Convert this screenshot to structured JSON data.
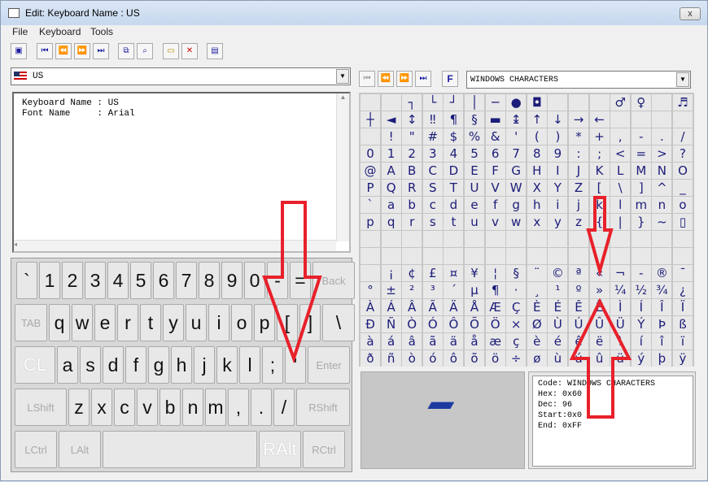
{
  "window": {
    "title": "Edit:  Keyboard Name : US",
    "close": "x"
  },
  "menu": [
    "File",
    "Keyboard",
    "Tools"
  ],
  "toolbar": {
    "icons": [
      "save-icon",
      "first-icon",
      "prev-icon",
      "next-icon",
      "last-icon",
      "copy-icon",
      "find-icon",
      "new-icon",
      "delete-icon",
      "print-preview-icon"
    ]
  },
  "left": {
    "combo_value": "US",
    "info_text": "Keyboard Name : US\nFont Name     : Arial",
    "keyboard": [
      [
        "`",
        "1",
        "2",
        "3",
        "4",
        "5",
        "6",
        "7",
        "8",
        "9",
        "0",
        "-",
        "=",
        "Back"
      ],
      [
        "TAB",
        "q",
        "w",
        "e",
        "r",
        "t",
        "y",
        "u",
        "i",
        "o",
        "p",
        "[",
        "]",
        "\\"
      ],
      [
        "CL",
        "a",
        "s",
        "d",
        "f",
        "g",
        "h",
        "j",
        "k",
        "l",
        ";",
        "'",
        "Enter"
      ],
      [
        "LShift",
        "z",
        "x",
        "c",
        "v",
        "b",
        "n",
        "m",
        ",",
        ".",
        "/",
        "RShift"
      ],
      [
        "LCtrl",
        "LAlt",
        "",
        "RAlt",
        "RCtrl"
      ]
    ]
  },
  "right": {
    "font_button": "F",
    "combo_value": "WINDOWS CHARACTERS",
    "grid": [
      [
        "",
        "",
        "┐",
        "└",
        "┘",
        "│",
        "─",
        "●",
        "◘",
        "",
        "",
        "",
        "♂",
        "♀",
        "",
        "♬",
        "☼"
      ],
      [
        "┼",
        "◄",
        "↕",
        "‼",
        "¶",
        "§",
        "▬",
        "↨",
        "↑",
        "↓",
        "→",
        "←",
        "",
        "",
        "",
        "",
        ""
      ],
      [
        "",
        "!",
        "\"",
        "#",
        "$",
        "%",
        "&",
        "'",
        "(",
        ")",
        "*",
        "+",
        ",",
        "-",
        ".",
        "/"
      ],
      [
        "0",
        "1",
        "2",
        "3",
        "4",
        "5",
        "6",
        "7",
        "8",
        "9",
        ":",
        ";",
        "<",
        "=",
        ">",
        "?"
      ],
      [
        "@",
        "A",
        "B",
        "C",
        "D",
        "E",
        "F",
        "G",
        "H",
        "I",
        "J",
        "K",
        "L",
        "M",
        "N",
        "O"
      ],
      [
        "P",
        "Q",
        "R",
        "S",
        "T",
        "U",
        "V",
        "W",
        "X",
        "Y",
        "Z",
        "[",
        "\\",
        "]",
        "^",
        "_"
      ],
      [
        "`",
        "a",
        "b",
        "c",
        "d",
        "e",
        "f",
        "g",
        "h",
        "i",
        "j",
        "k",
        "l",
        "m",
        "n",
        "o"
      ],
      [
        "p",
        "q",
        "r",
        "s",
        "t",
        "u",
        "v",
        "w",
        "x",
        "y",
        "z",
        "{",
        "|",
        "}",
        "~",
        "▯"
      ],
      [
        "",
        "",
        "",
        "",
        "",
        "",
        "",
        "",
        "",
        "",
        "",
        "",
        "",
        "",
        "",
        ""
      ],
      [
        "",
        "",
        "",
        "",
        "",
        "",
        "",
        "",
        "",
        "",
        "",
        "",
        "",
        "",
        "",
        ""
      ],
      [
        "",
        "¡",
        "¢",
        "£",
        "¤",
        "¥",
        "¦",
        "§",
        "¨",
        "©",
        "ª",
        "«",
        "¬",
        "-",
        "®",
        "¯"
      ],
      [
        "°",
        "±",
        "²",
        "³",
        "´",
        "µ",
        "¶",
        "·",
        "¸",
        "¹",
        "º",
        "»",
        "¼",
        "½",
        "¾",
        "¿"
      ],
      [
        "À",
        "Á",
        "Â",
        "Ã",
        "Ä",
        "Å",
        "Æ",
        "Ç",
        "È",
        "É",
        "Ê",
        "Ë",
        "Ì",
        "Í",
        "Î",
        "Ï"
      ],
      [
        "Ð",
        "Ñ",
        "Ò",
        "Ó",
        "Ô",
        "Õ",
        "Ö",
        "×",
        "Ø",
        "Ù",
        "Ú",
        "Û",
        "Ü",
        "Ý",
        "Þ",
        "ß"
      ],
      [
        "à",
        "á",
        "â",
        "ã",
        "ä",
        "å",
        "æ",
        "ç",
        "è",
        "é",
        "ê",
        "ë",
        "ì",
        "í",
        "î",
        "ï"
      ],
      [
        "ð",
        "ñ",
        "ò",
        "ó",
        "ô",
        "õ",
        "ö",
        "÷",
        "ø",
        "ù",
        "ú",
        "û",
        "ü",
        "ý",
        "þ",
        "ÿ"
      ]
    ],
    "details": {
      "code": "Code: WINDOWS CHARACTERS",
      "hex": "Hex:   0x60",
      "dec": "Dec:   96",
      "start": "Start:0x0",
      "end": "End:   0xFF"
    }
  },
  "annotation_color": "#e8202a"
}
